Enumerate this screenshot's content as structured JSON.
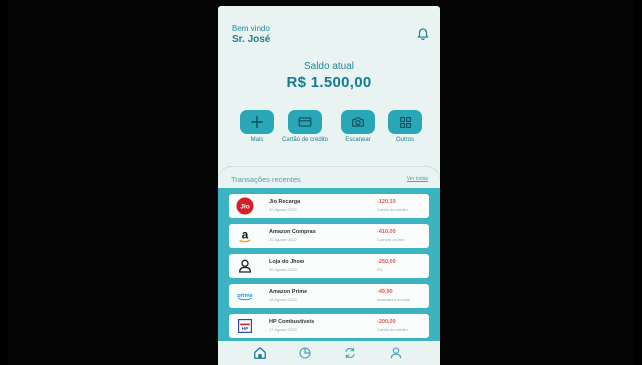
{
  "header": {
    "greeting": "Bem vindo",
    "user_name": "Sr. José"
  },
  "balance": {
    "label": "Saldo atual",
    "value": "R$ 1.500,00"
  },
  "actions": [
    {
      "label": "Mais",
      "icon": "plus-icon"
    },
    {
      "label": "Cartão de crédito",
      "icon": "card-icon"
    },
    {
      "label": "Escanear",
      "icon": "camera-icon"
    },
    {
      "label": "Outros",
      "icon": "grid-icon"
    }
  ],
  "transactions": {
    "title": "Transações recentes",
    "see_all": "Ver todas",
    "items": [
      {
        "name": "Jio Recarga",
        "date": "20 Agosto 2022",
        "amount": "-120,10",
        "type": "Cartão de crédito",
        "logo": "jio-logo"
      },
      {
        "name": "Amazon Compras",
        "date": "20 Agosto 2022",
        "amount": "-410,00",
        "type": "Compra on-line",
        "logo": "amazon-logo"
      },
      {
        "name": "Loja do Jhow",
        "date": "20 Agosto 2022",
        "amount": "-250,00",
        "type": "Pix",
        "logo": "user-logo"
      },
      {
        "name": "Amazon Prime",
        "date": "18 Agosto 2022",
        "amount": "-49,90",
        "type": "Assinatura mensal",
        "logo": "prime-logo"
      },
      {
        "name": "HP Combustíveis",
        "date": "17 Agosto 2022",
        "amount": "-200,00",
        "type": "Cartão de crédito",
        "logo": "hp-logo"
      }
    ]
  },
  "bottom_nav": [
    "home-icon",
    "chart-icon",
    "transfer-icon",
    "profile-icon"
  ],
  "colors": {
    "accent": "#2aa7b6",
    "panel": "#3cb4c0",
    "negative": "#e25b4c",
    "background": "#e9f3f2"
  }
}
